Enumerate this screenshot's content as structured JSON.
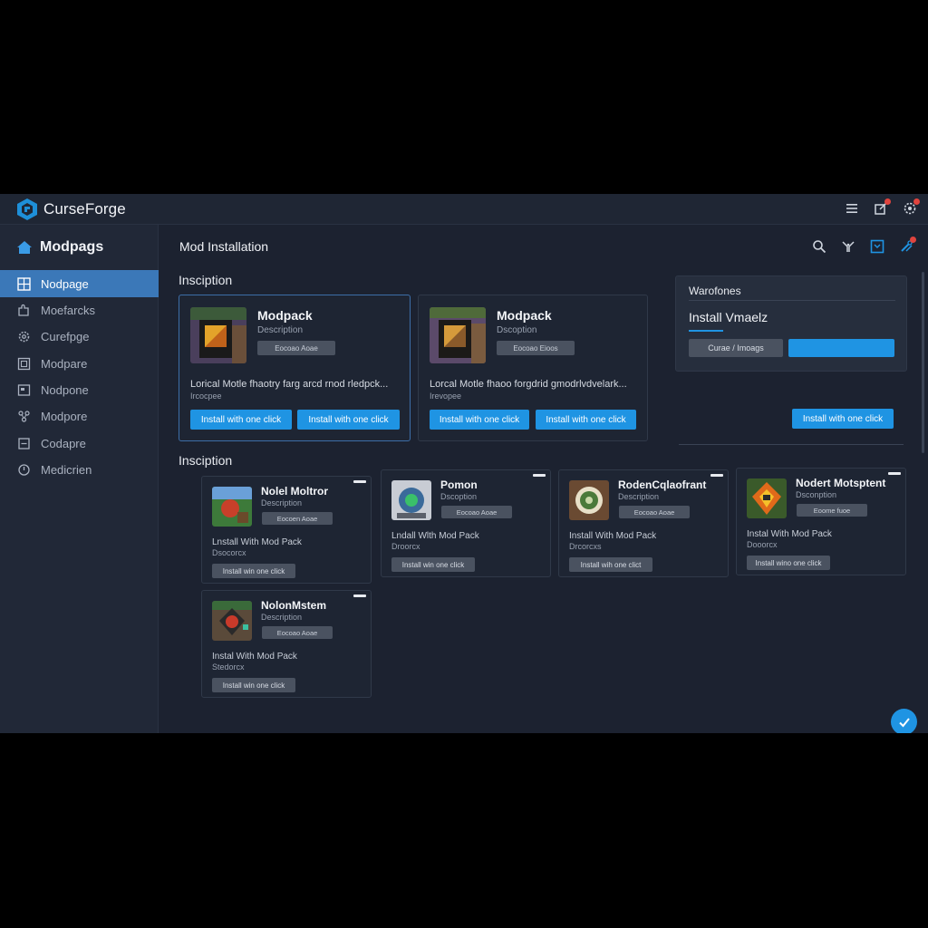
{
  "app": {
    "name": "CurseForge"
  },
  "sidebar": {
    "heading": "Modpags",
    "items": [
      {
        "label": "Nodpage",
        "icon": "grid-icon",
        "active": true
      },
      {
        "label": "Moefarcks",
        "icon": "puzzle-icon"
      },
      {
        "label": "Curefpge",
        "icon": "gear-icon"
      },
      {
        "label": "Modpare",
        "icon": "box-icon"
      },
      {
        "label": "Nodpone",
        "icon": "window-icon"
      },
      {
        "label": "Modpore",
        "icon": "nodes-icon"
      },
      {
        "label": "Codapre",
        "icon": "square-icon"
      },
      {
        "label": "Medicrien",
        "icon": "clock-icon"
      }
    ]
  },
  "main": {
    "title": "Mod Installation",
    "section1": "Insciption",
    "section2": "Insciption",
    "featured": [
      {
        "name": "Modpack",
        "desc": "Description",
        "tag": "Eocoao Aoae",
        "line1": "Lorical Motle fhaotry farg arcd rnod rledpck...",
        "line2": "Ircocpee",
        "btn1": "Install with one click",
        "btn2": "Install with one click"
      },
      {
        "name": "Modpack",
        "desc": "Dscoption",
        "tag": "Eocoao Eioos",
        "line1": "Lorcal Motle fhaoo forgdrid gmodrlvdvelark...",
        "line2": "Irevopee",
        "btn1": "Install with one click",
        "btn2": "Install with one click"
      }
    ],
    "right_panel": {
      "title": "Warofones",
      "label": "Install Vmaelz",
      "gray_btn": "Curae / Imoags",
      "bottom_btn": "Install with one click"
    },
    "cards": [
      {
        "name": "Nolel Moltror",
        "desc": "Description",
        "tag": "Eocoen Aoae",
        "line1": "Lnstall With Mod Pack",
        "line2": "Dsocorcx",
        "btn": "Install win one click"
      },
      {
        "name": "Pomon",
        "desc": "Dscoption",
        "tag": "Eocoao Aoae",
        "line1": "Lndall Wlth Mod Pack",
        "line2": "Droorcx",
        "btn": "Install win one click"
      },
      {
        "name": "RodenCqlaofrant",
        "desc": "Description",
        "tag": "Eocoao Aoae",
        "line1": "Install With Mod Pack",
        "line2": "Drcorcxs",
        "btn": "Install wih one clict"
      },
      {
        "name": "Nodert Motsptent",
        "desc": "Dsconption",
        "tag": "Eoome fuoe",
        "line1": "Instal With Mod Pack",
        "line2": "Dooorcx",
        "btn": "Install wino one click"
      },
      {
        "name": "NolonMstem",
        "desc": "Description",
        "tag": "Eocoao Aoae",
        "line1": "Instal With Mod Pack",
        "line2": "Stedorcx",
        "btn": "Install win one click"
      }
    ]
  },
  "colors": {
    "accent": "#1f94e3",
    "active_nav": "#3b78b8",
    "bg": "#1c2230",
    "notification": "#e0443e"
  }
}
